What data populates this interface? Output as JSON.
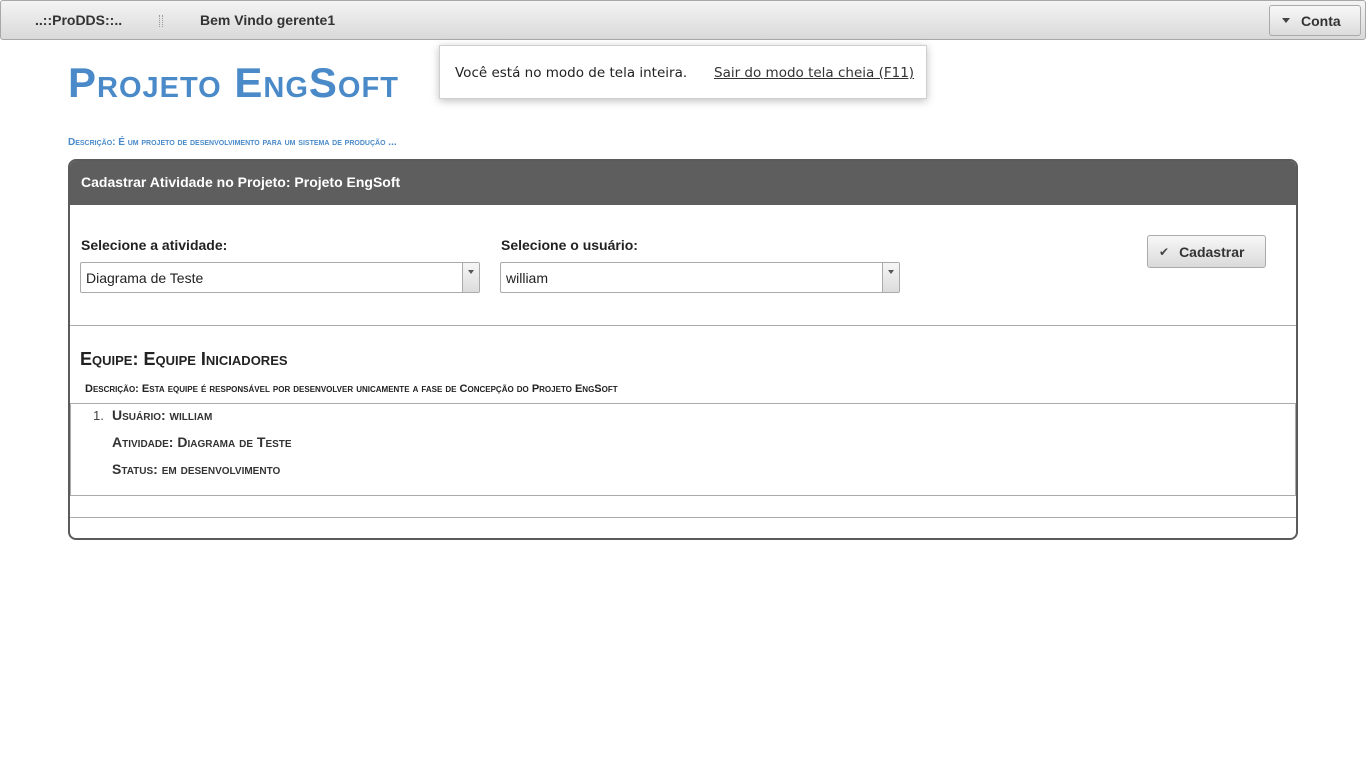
{
  "menubar": {
    "brand": "..::ProDDS::..",
    "welcome": "Bem Vindo gerente1",
    "account_label": "Conta"
  },
  "fullscreen_notice": {
    "message": "Você está no modo de tela inteira.",
    "exit_link": "Sair do modo tela cheia (F11)"
  },
  "project": {
    "title": "Projeto EngSoft",
    "description": "Descrição: É um projeto de desenvolvimento para um sistema de produção ..."
  },
  "panel": {
    "header": "Cadastrar Atividade no Projeto: Projeto EngSoft",
    "activity_label": "Selecione a atividade:",
    "activity_value": "Diagrama de Teste",
    "user_label": "Selecione o usuário:",
    "user_value": "william",
    "submit_label": "Cadastrar"
  },
  "team": {
    "title": "Equipe: Equipe Iniciadores",
    "description": "Descrição: Esta equipe é responsável por desenvolver unicamente a fase de Concepção do Projeto EngSoft",
    "members": [
      {
        "number": "1.",
        "user": "Usuário: william",
        "activity": "Atividade: Diagrama de Teste",
        "status": "Status: em desenvolvimento"
      }
    ]
  },
  "colors": {
    "brand_blue": "#4a8ac9",
    "panel_header": "#5e5e5e"
  }
}
